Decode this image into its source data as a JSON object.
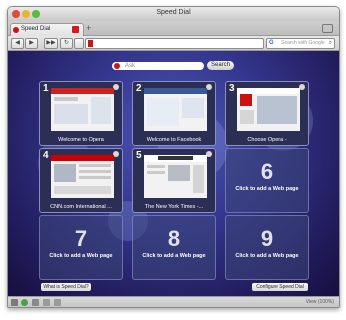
{
  "window": {
    "title": "Speed Dial"
  },
  "tab": {
    "label": "Speed Dial",
    "new_tab_symbol": "+"
  },
  "toolbar": {
    "back": "◀",
    "forward": "▶",
    "fast_forward": "▶▶",
    "reload": "↻",
    "search_placeholder": "Search with Google",
    "search_engine_icon": "G"
  },
  "speed_dial": {
    "ask_placeholder": "Ask",
    "search_button": "Search",
    "tiles": [
      {
        "number": "1",
        "label": "Welcome to Opera",
        "filled": true,
        "accent": "#cc2222"
      },
      {
        "number": "2",
        "label": "Welcome to Facebook",
        "filled": true,
        "accent": "#3b5998"
      },
      {
        "number": "3",
        "label": "Choose Opera -",
        "filled": true,
        "accent": "#cc1111"
      },
      {
        "number": "4",
        "label": "CNN.com International ...",
        "filled": true,
        "accent": "#cc0000"
      },
      {
        "number": "5",
        "label": "The New York Times -...",
        "filled": true,
        "accent": "#222222"
      },
      {
        "number": "6",
        "label": "Click to add a Web page",
        "filled": false
      },
      {
        "number": "7",
        "label": "Click to add a Web page",
        "filled": false
      },
      {
        "number": "8",
        "label": "Click to add a Web page",
        "filled": false
      },
      {
        "number": "9",
        "label": "Click to add a Web page",
        "filled": false
      }
    ],
    "what_is_button": "What is Speed Dial?",
    "configure_button": "Configure Speed Dial"
  },
  "statusbar": {
    "zoom": "View (100%)"
  },
  "colors": {
    "background": "#2a2670",
    "accent_red": "#cc1111"
  }
}
